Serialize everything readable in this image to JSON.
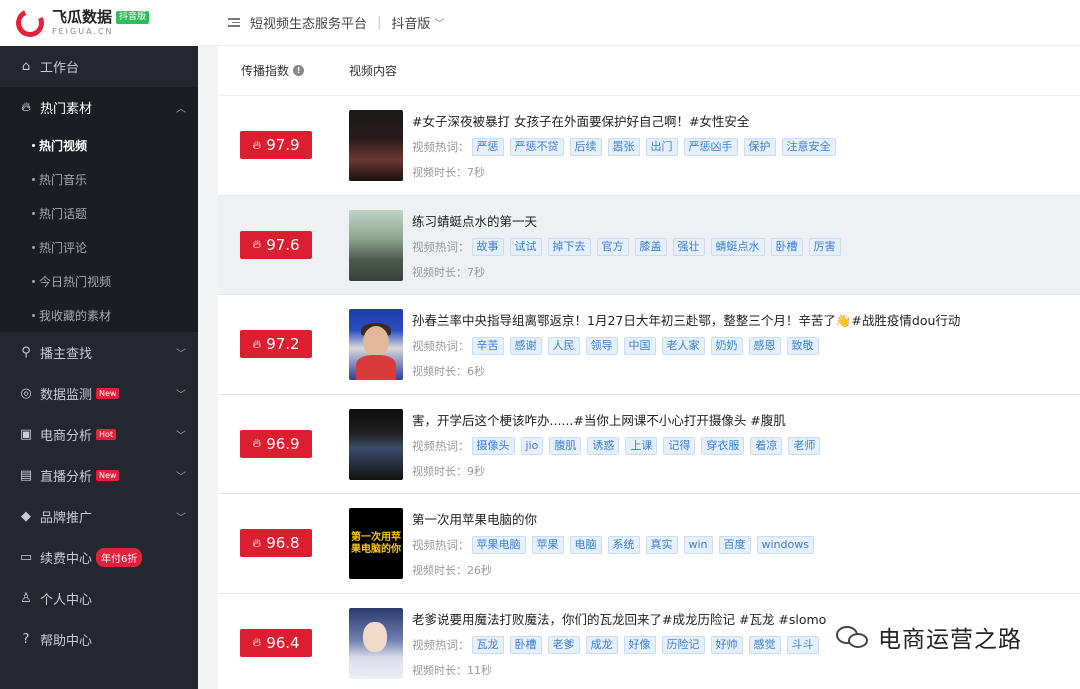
{
  "brand": {
    "name": "飞瓜数据",
    "badge": "抖音版",
    "sub": "FEIGUA.CN"
  },
  "topbar": {
    "platform": "短视频生态服务平台",
    "version": "抖音版"
  },
  "sidebar": {
    "items": [
      {
        "label": "工作台",
        "icon": "home-icon"
      },
      {
        "label": "热门素材",
        "icon": "flame-icon"
      },
      {
        "label": "播主查找",
        "icon": "search-icon"
      },
      {
        "label": "数据监测",
        "icon": "monitor-icon",
        "badge": "New"
      },
      {
        "label": "电商分析",
        "icon": "shop-icon",
        "badge": "Hot"
      },
      {
        "label": "直播分析",
        "icon": "live-icon",
        "badge": "New"
      },
      {
        "label": "品牌推广",
        "icon": "diamond-icon"
      },
      {
        "label": "续费中心",
        "icon": "card-icon",
        "badge": "年付6折"
      },
      {
        "label": "个人中心",
        "icon": "user-icon"
      },
      {
        "label": "帮助中心",
        "icon": "help-icon"
      }
    ],
    "sub_items": [
      {
        "label": "热门视频",
        "active": true
      },
      {
        "label": "热门音乐"
      },
      {
        "label": "热门话题"
      },
      {
        "label": "热门评论"
      },
      {
        "label": "今日热门视频"
      },
      {
        "label": "我收藏的素材"
      }
    ]
  },
  "table": {
    "col_score": "传播指数",
    "col_content": "视频内容",
    "tag_label": "视频热词：",
    "duration_label": "视频时长：",
    "rows": [
      {
        "score": "97.9",
        "title": "#女子深夜被暴打 女孩子在外面要保护好自己啊！#女性安全",
        "tags": [
          "严惩",
          "严惩不贷",
          "后续",
          "嚣张",
          "出门",
          "严惩凶手",
          "保护",
          "注意安全"
        ],
        "duration": "7秒"
      },
      {
        "score": "97.6",
        "title": "练习蜻蜓点水的第一天",
        "tags": [
          "故事",
          "试试",
          "掉下去",
          "官方",
          "膝盖",
          "强壮",
          "蜻蜓点水",
          "卧槽",
          "厉害"
        ],
        "duration": "7秒"
      },
      {
        "score": "97.2",
        "title": "孙春兰率中央指导组离鄂返京！1月27日大年初三赴鄂，整整三个月！辛苦了👋#战胜疫情dou行动",
        "tags": [
          "辛苦",
          "感谢",
          "人民",
          "领导",
          "中国",
          "老人家",
          "奶奶",
          "感恩",
          "致敬"
        ],
        "duration": "6秒"
      },
      {
        "score": "96.9",
        "title": "害，开学后这个梗该咋办......#当你上网课不小心打开摄像头 #腹肌",
        "tags": [
          "摄像头",
          "jio",
          "腹肌",
          "诱惑",
          "上课",
          "记得",
          "穿衣服",
          "着凉",
          "老师"
        ],
        "duration": "9秒"
      },
      {
        "score": "96.8",
        "title": "第一次用苹果电脑的你",
        "tags": [
          "苹果电脑",
          "苹果",
          "电脑",
          "系统",
          "真实",
          "win",
          "百度",
          "windows"
        ],
        "duration": "26秒",
        "thumb_text": "第一次用苹果电脑的你"
      },
      {
        "score": "96.4",
        "title": "老爹说要用魔法打败魔法，你们的瓦龙回来了#成龙历险记 #瓦龙 #slomo",
        "tags": [
          "瓦龙",
          "卧槽",
          "老爹",
          "成龙",
          "好像",
          "历险记",
          "好帅",
          "感觉",
          "斗斗"
        ],
        "duration": "11秒"
      }
    ]
  },
  "watermark": "电商运营之路"
}
